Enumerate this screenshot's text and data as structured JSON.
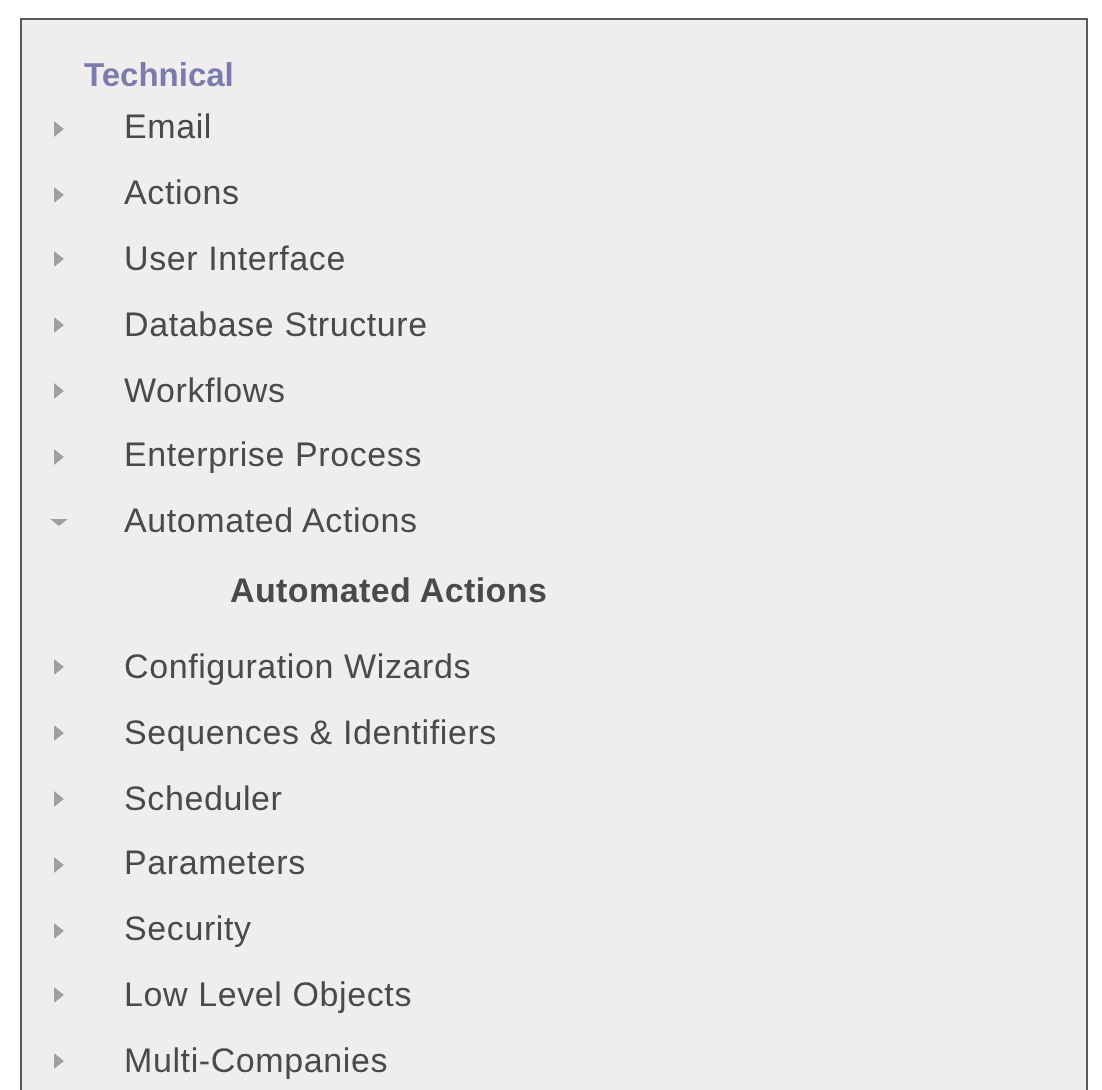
{
  "heading": "Technical",
  "items": [
    {
      "label": "Email",
      "expanded": false
    },
    {
      "label": "Actions",
      "expanded": false
    },
    {
      "label": "User Interface",
      "expanded": false
    },
    {
      "label": "Database Structure",
      "expanded": false
    },
    {
      "label": "Workflows",
      "expanded": false
    },
    {
      "label": "Enterprise Process",
      "expanded": false
    },
    {
      "label": "Automated Actions",
      "expanded": true,
      "children": [
        {
          "label": "Automated Actions"
        }
      ]
    },
    {
      "label": "Configuration Wizards",
      "expanded": false
    },
    {
      "label": "Sequences & Identifiers",
      "expanded": false
    },
    {
      "label": "Scheduler",
      "expanded": false
    },
    {
      "label": "Parameters",
      "expanded": false
    },
    {
      "label": "Security",
      "expanded": false
    },
    {
      "label": "Low Level Objects",
      "expanded": false
    },
    {
      "label": "Multi-Companies",
      "expanded": false
    }
  ]
}
